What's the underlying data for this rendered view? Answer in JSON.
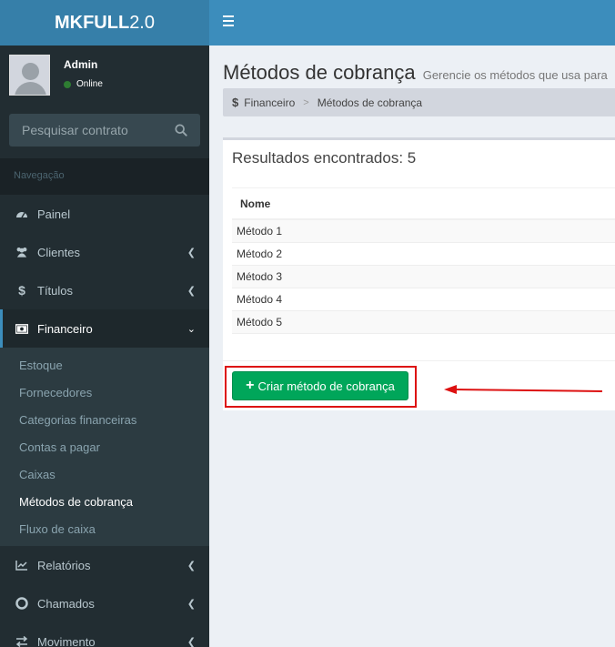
{
  "logo": {
    "bold": "MKFULL",
    "light": "2.0"
  },
  "user": {
    "name": "Admin",
    "status": "Online"
  },
  "search": {
    "placeholder": "Pesquisar contrato"
  },
  "nav": {
    "header": "Navegação",
    "items": [
      {
        "label": "Painel",
        "icon": "dashboard-icon"
      },
      {
        "label": "Clientes",
        "icon": "users-icon"
      },
      {
        "label": "Títulos",
        "icon": "dollar-icon"
      },
      {
        "label": "Financeiro",
        "icon": "money-icon"
      }
    ],
    "financeiro_sub": [
      "Estoque",
      "Fornecedores",
      "Categorias financeiras",
      "Contas a pagar",
      "Caixas",
      "Métodos de cobrança",
      "Fluxo de caixa"
    ],
    "items_after": [
      {
        "label": "Relatórios",
        "icon": "chart-icon"
      },
      {
        "label": "Chamados",
        "icon": "lifebuoy-icon"
      },
      {
        "label": "Movimento",
        "icon": "exchange-icon"
      }
    ]
  },
  "page": {
    "title": "Métodos de cobrança",
    "subtitle": "Gerencie os métodos que usa para"
  },
  "breadcrumb": {
    "root": "Financeiro",
    "separator": ">",
    "current": "Métodos de cobrança"
  },
  "results": {
    "title": "Resultados encontrados: 5",
    "column": "Nome",
    "rows": [
      "Método 1",
      "Método 2",
      "Método 3",
      "Método 4",
      "Método 5"
    ]
  },
  "actions": {
    "create_label": "Criar método de cobrança"
  },
  "colors": {
    "header": "#3c8dbc",
    "logo_bg": "#367fa9",
    "sidebar": "#222d32",
    "success": "#00a65a",
    "highlight": "#dd1111"
  }
}
